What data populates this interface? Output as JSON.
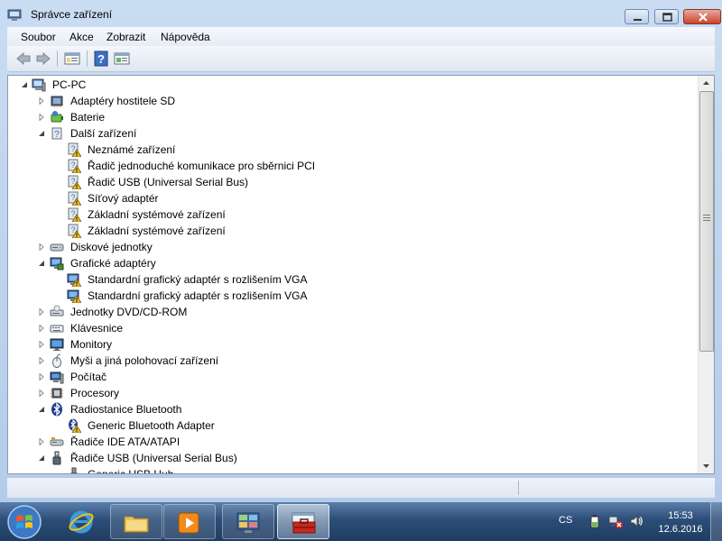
{
  "window": {
    "title": "Správce zařízení"
  },
  "menu": {
    "items": [
      "Soubor",
      "Akce",
      "Zobrazit",
      "Nápověda"
    ]
  },
  "tree": {
    "root": "PC-PC",
    "items": [
      {
        "label": "Adaptéry hostitele SD",
        "level": 1,
        "state": "collapsed",
        "icon": "sd-host-adapter-icon"
      },
      {
        "label": "Baterie",
        "level": 1,
        "state": "collapsed",
        "icon": "battery-icon"
      },
      {
        "label": "Další zařízení",
        "level": 1,
        "state": "expanded",
        "icon": "other-devices-icon"
      },
      {
        "label": "Neznámé zařízení",
        "level": 2,
        "state": "leaf",
        "icon": "unknown-device-warning-icon"
      },
      {
        "label": "Řadič jednoduché komunikace pro sběrnici PCI",
        "level": 2,
        "state": "leaf",
        "icon": "unknown-device-warning-icon"
      },
      {
        "label": "Řadič USB (Universal Serial Bus)",
        "level": 2,
        "state": "leaf",
        "icon": "unknown-device-warning-icon"
      },
      {
        "label": "Síťový adaptér",
        "level": 2,
        "state": "leaf",
        "icon": "unknown-device-warning-icon"
      },
      {
        "label": "Základní systémové zařízení",
        "level": 2,
        "state": "leaf",
        "icon": "unknown-device-warning-icon"
      },
      {
        "label": "Základní systémové zařízení",
        "level": 2,
        "state": "leaf",
        "icon": "unknown-device-warning-icon"
      },
      {
        "label": "Diskové jednotky",
        "level": 1,
        "state": "collapsed",
        "icon": "disk-drive-icon"
      },
      {
        "label": "Grafické adaptéry",
        "level": 1,
        "state": "expanded",
        "icon": "display-adapter-icon"
      },
      {
        "label": "Standardní grafický adaptér s rozlišením VGA",
        "level": 2,
        "state": "leaf",
        "icon": "display-adapter-warning-icon"
      },
      {
        "label": "Standardní grafický adaptér s rozlišením VGA",
        "level": 2,
        "state": "leaf",
        "icon": "display-adapter-warning-icon"
      },
      {
        "label": "Jednotky DVD/CD-ROM",
        "level": 1,
        "state": "collapsed",
        "icon": "dvd-drive-icon"
      },
      {
        "label": "Klávesnice",
        "level": 1,
        "state": "collapsed",
        "icon": "keyboard-icon"
      },
      {
        "label": "Monitory",
        "level": 1,
        "state": "collapsed",
        "icon": "monitor-icon"
      },
      {
        "label": "Myši a jiná polohovací zařízení",
        "level": 1,
        "state": "collapsed",
        "icon": "mouse-icon"
      },
      {
        "label": "Počítač",
        "level": 1,
        "state": "collapsed",
        "icon": "computer-icon"
      },
      {
        "label": "Procesory",
        "level": 1,
        "state": "collapsed",
        "icon": "processor-icon"
      },
      {
        "label": "Radiostanice Bluetooth",
        "level": 1,
        "state": "expanded",
        "icon": "bluetooth-icon"
      },
      {
        "label": "Generic Bluetooth Adapter",
        "level": 2,
        "state": "leaf",
        "icon": "bluetooth-warning-icon"
      },
      {
        "label": "Řadiče IDE ATA/ATAPI",
        "level": 1,
        "state": "collapsed",
        "icon": "ide-controller-icon"
      },
      {
        "label": "Řadiče USB (Universal Serial Bus)",
        "level": 1,
        "state": "expanded",
        "icon": "usb-icon"
      },
      {
        "label": "Generic USB Hub",
        "level": 2,
        "state": "leaf",
        "icon": "usb-device-icon"
      }
    ]
  },
  "taskbar": {
    "language": "CS",
    "time": "15:53",
    "date": "12.6.2016"
  },
  "colors": {
    "warning": "#f2c12e",
    "window_frame": "#c3d6ee",
    "taskbar": "#2c4d77"
  }
}
